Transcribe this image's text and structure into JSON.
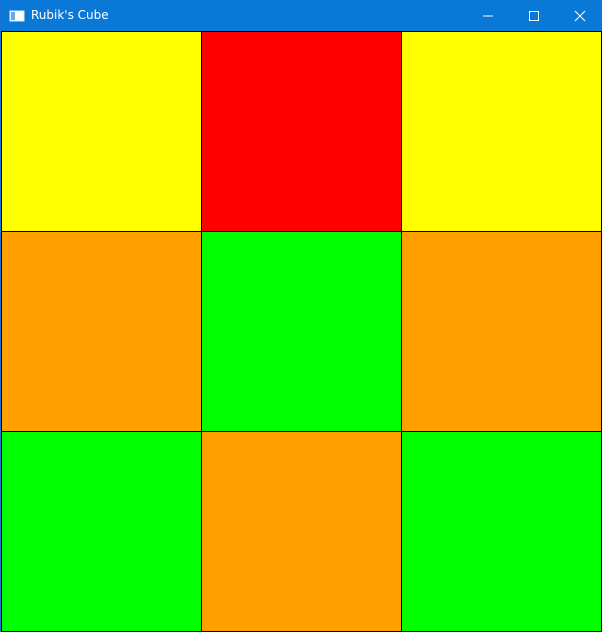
{
  "window": {
    "title": "Rubik's Cube",
    "app_icon": "window-app-icon",
    "controls": {
      "minimize_icon": "minimize-icon",
      "maximize_icon": "maximize-icon",
      "close_icon": "close-icon"
    }
  },
  "colors": {
    "titlebar": "#0a78d7",
    "yellow": "#ffff00",
    "red": "#ff0000",
    "orange": "#ffa000",
    "green": "#00ff00",
    "grid_line": "#000000"
  },
  "face": {
    "rows": [
      [
        "yellow",
        "red",
        "yellow"
      ],
      [
        "orange",
        "green",
        "orange"
      ],
      [
        "green",
        "orange",
        "green"
      ]
    ]
  }
}
